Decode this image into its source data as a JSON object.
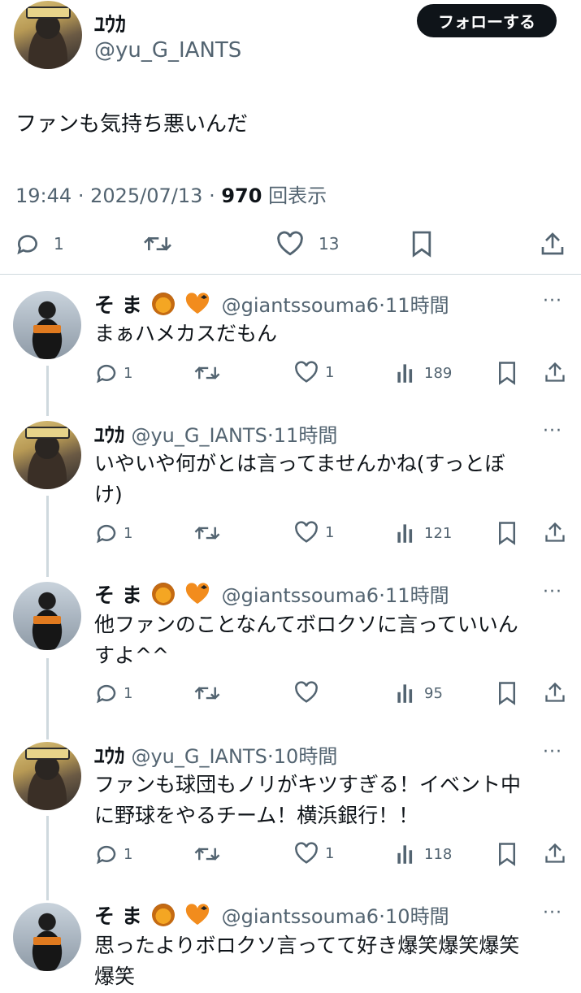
{
  "main_tweet": {
    "author_name": "ﾕｳｶ",
    "author_handle": "@yu_G_IANTS",
    "follow_label": "フォローする",
    "text": "ファンも気持ち悪いんだ",
    "time": "19:44",
    "date": "2025/07/13",
    "views_count": "970",
    "views_label": "回表示",
    "replies": "1",
    "likes": "13"
  },
  "replies": [
    {
      "name": "そ ま",
      "handle": "@giantssouma6",
      "time": "11時間",
      "text": "まぁハメカスだもん",
      "replies": "1",
      "likes": "1",
      "views": "189"
    },
    {
      "name": "ﾕｳｶ",
      "handle": "@yu_G_IANTS",
      "time": "11時間",
      "text_line1": "いやいや何がとは言ってませんかね(すっとぼ",
      "text_line2": "け)",
      "replies": "1",
      "likes": "1",
      "views": "121"
    },
    {
      "name": "そ ま",
      "handle": "@giantssouma6",
      "time": "11時間",
      "text_line1": "他ファンのことなんてボロクソに言っていいん",
      "text_line2": "すよ^^",
      "replies": "1",
      "likes": "",
      "views": "95"
    },
    {
      "name": "ﾕｳｶ",
      "handle": "@yu_G_IANTS",
      "time": "10時間",
      "text_line1": "ファンも球団もノリがキツすぎる！イベント中",
      "text_line2": "に野球をやるチーム！横浜銀行！！",
      "replies": "1",
      "likes": "1",
      "views": "118"
    },
    {
      "name": "そ ま",
      "handle": "@giantssouma6",
      "time": "10時間",
      "text_line1": "思ったよりボロクソ言ってて好き爆笑爆笑爆笑",
      "text_line2": "爆笑"
    }
  ],
  "separator": "·",
  "more_label": "···",
  "colors": {
    "text": "#0f1419",
    "secondary": "#536471",
    "divider": "#cfd9de",
    "button": "#0f1419"
  }
}
